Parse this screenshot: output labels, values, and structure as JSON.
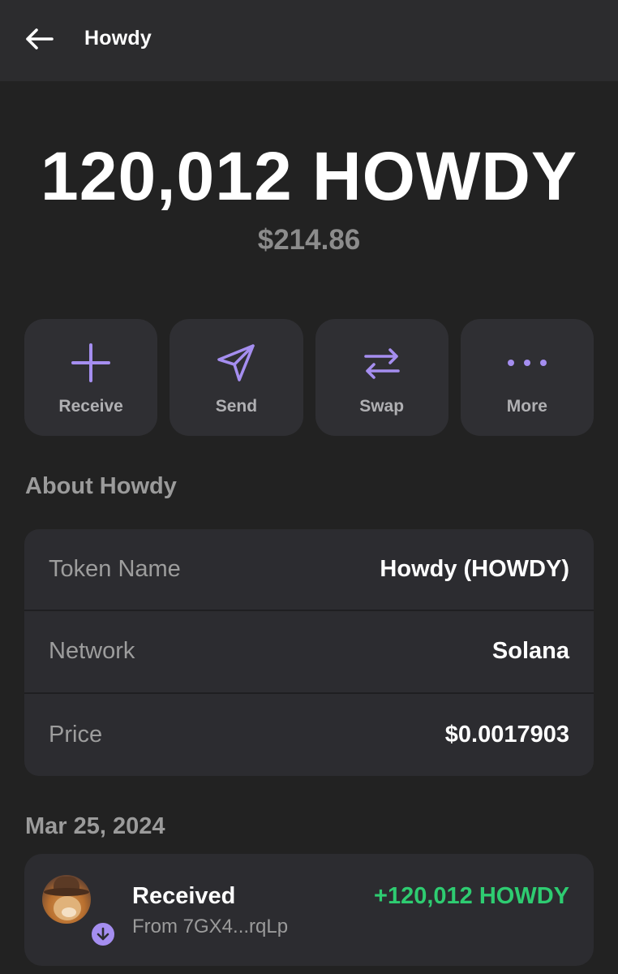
{
  "header": {
    "title": "Howdy",
    "back_icon": "arrow-left-icon"
  },
  "balance": {
    "amount": "120,012 HOWDY",
    "usd": "$214.86"
  },
  "actions": [
    {
      "label": "Receive",
      "icon": "plus-icon"
    },
    {
      "label": "Send",
      "icon": "paper-plane-icon"
    },
    {
      "label": "Swap",
      "icon": "swap-arrows-icon"
    },
    {
      "label": "More",
      "icon": "more-dots-icon"
    }
  ],
  "about": {
    "title": "About Howdy",
    "rows": [
      {
        "label": "Token Name",
        "value": "Howdy (HOWDY)"
      },
      {
        "label": "Network",
        "value": "Solana"
      },
      {
        "label": "Price",
        "value": "$0.0017903"
      }
    ]
  },
  "activity": {
    "date": "Mar 25, 2024",
    "items": [
      {
        "title": "Received",
        "subtitle": "From 7GX4...rqLp",
        "amount": "+120,012 HOWDY",
        "badge_icon": "arrow-down-icon"
      }
    ]
  },
  "colors": {
    "accent": "#a58ef0",
    "positive": "#2ecc71",
    "background": "#222222",
    "card": "#2c2c30"
  }
}
